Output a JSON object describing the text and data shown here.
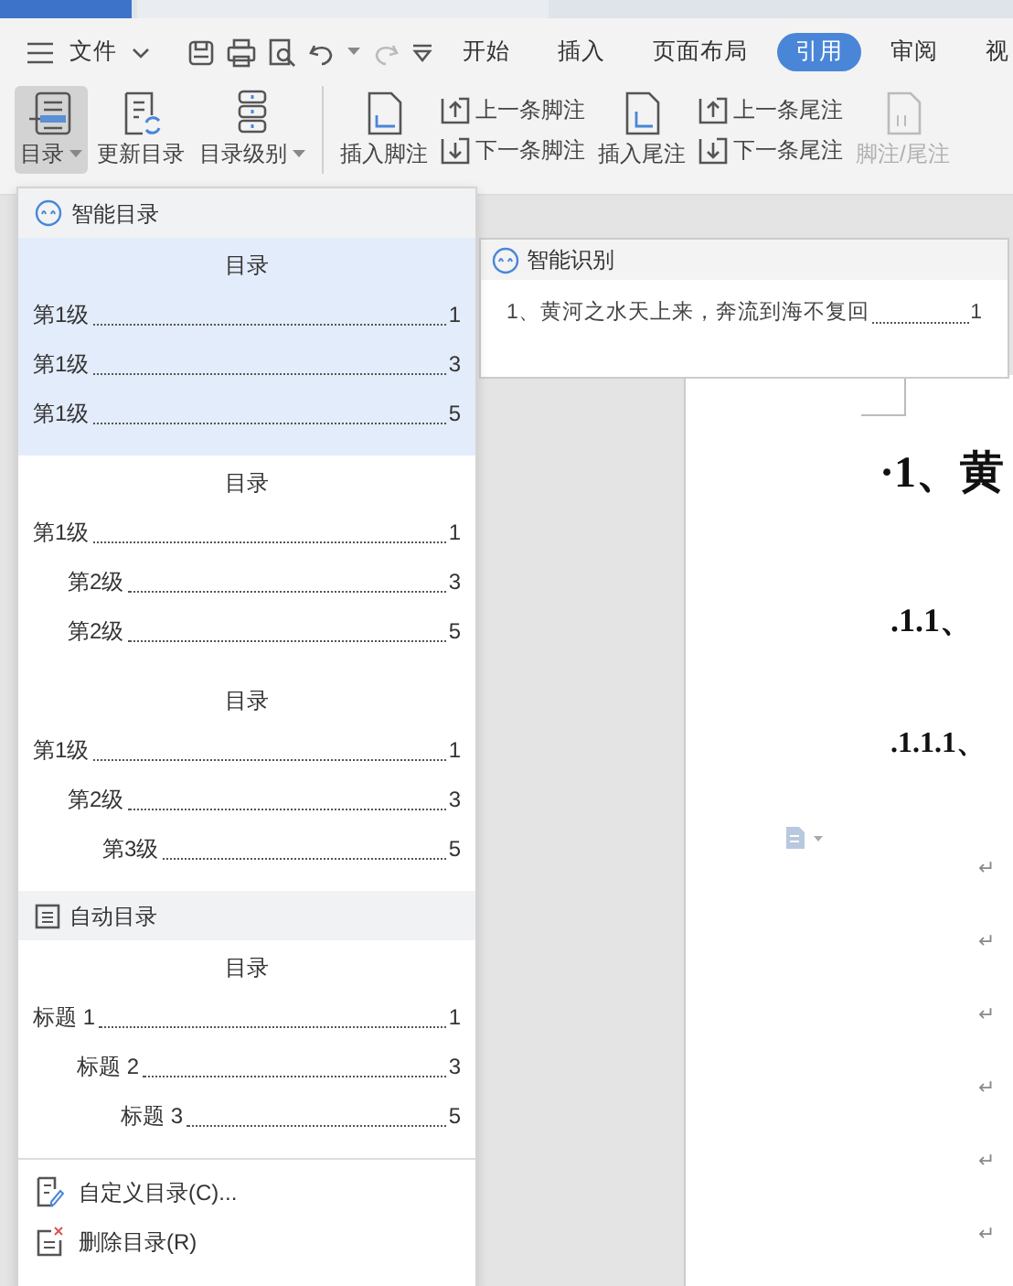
{
  "file_menu": "文件",
  "ribbon_tabs": [
    {
      "label": "开始",
      "selected": false
    },
    {
      "label": "插入",
      "selected": false
    },
    {
      "label": "页面布局",
      "selected": false
    },
    {
      "label": "引用",
      "selected": true
    },
    {
      "label": "审阅",
      "selected": false
    },
    {
      "label": "视",
      "selected": false
    }
  ],
  "ribbon_buttons": [
    {
      "kind": "large",
      "label": "目录",
      "pressed": true,
      "dropdown": true
    },
    {
      "kind": "large",
      "label": "更新目录",
      "pressed": false,
      "dropdown": false
    },
    {
      "kind": "large",
      "label": "目录级别",
      "pressed": false,
      "dropdown": true
    },
    {
      "kind": "large",
      "label": "插入脚注",
      "pressed": false,
      "dropdown": false
    },
    {
      "kind": "stack",
      "items": [
        {
          "label": "上一条脚注"
        },
        {
          "label": "下一条脚注"
        }
      ]
    },
    {
      "kind": "large",
      "label": "插入尾注",
      "pressed": false,
      "dropdown": false
    },
    {
      "kind": "stack",
      "items": [
        {
          "label": "上一条尾注"
        },
        {
          "label": "下一条尾注"
        }
      ]
    },
    {
      "kind": "large",
      "label": "脚注/尾注",
      "pressed": false,
      "dropdown": false,
      "disabled": true
    }
  ],
  "toc_menu": {
    "sections": [
      {
        "kind": "smart",
        "title": "智能目录",
        "previews": [
          {
            "title": "目录",
            "selected": true,
            "entries": [
              {
                "text": "第1级",
                "page": "1"
              },
              {
                "text": "第1级",
                "page": "3"
              },
              {
                "text": "第1级",
                "page": "5"
              }
            ]
          },
          {
            "title": "目录",
            "selected": false,
            "entries": [
              {
                "text": "第1级",
                "page": "1",
                "children": [
                  {
                    "text": "第2级",
                    "page": "3"
                  },
                  {
                    "text": "第2级",
                    "page": "5"
                  }
                ]
              }
            ]
          },
          {
            "title": "目录",
            "selected": false,
            "entries": [
              {
                "text": "第1级",
                "page": "1",
                "children": [
                  {
                    "text": "第2级",
                    "page": "3",
                    "children": [
                      {
                        "text": "第3级",
                        "page": "5"
                      }
                    ]
                  }
                ]
              }
            ]
          }
        ]
      },
      {
        "kind": "auto",
        "title": "自动目录",
        "previews": [
          {
            "title": "目录",
            "selected": false,
            "entries": [
              {
                "text": "标题 1",
                "page": "1",
                "children": [
                  {
                    "text": "标题 2",
                    "page": "3",
                    "children": [
                      {
                        "text": "标题 3",
                        "page": "5"
                      }
                    ]
                  }
                ]
              }
            ]
          }
        ]
      }
    ],
    "actions": [
      {
        "kind": "customize",
        "label": "自定义目录(C)..."
      },
      {
        "kind": "delete",
        "label": "删除目录(R)"
      }
    ]
  },
  "smart_popup": {
    "title": "智能识别",
    "entry": {
      "text": "1、黄河之水天上来，奔流到海不复回",
      "page": "1"
    }
  },
  "document": {
    "headings": [
      {
        "kind": "h1",
        "text": "·1、黄"
      },
      {
        "kind": "h2",
        "text": ".1.1、"
      },
      {
        "kind": "h3",
        "text": ".1.1.1、"
      }
    ],
    "paragraph_marks": [
      "↵",
      "↵",
      "↵",
      "↵",
      "↵",
      "↵"
    ]
  }
}
